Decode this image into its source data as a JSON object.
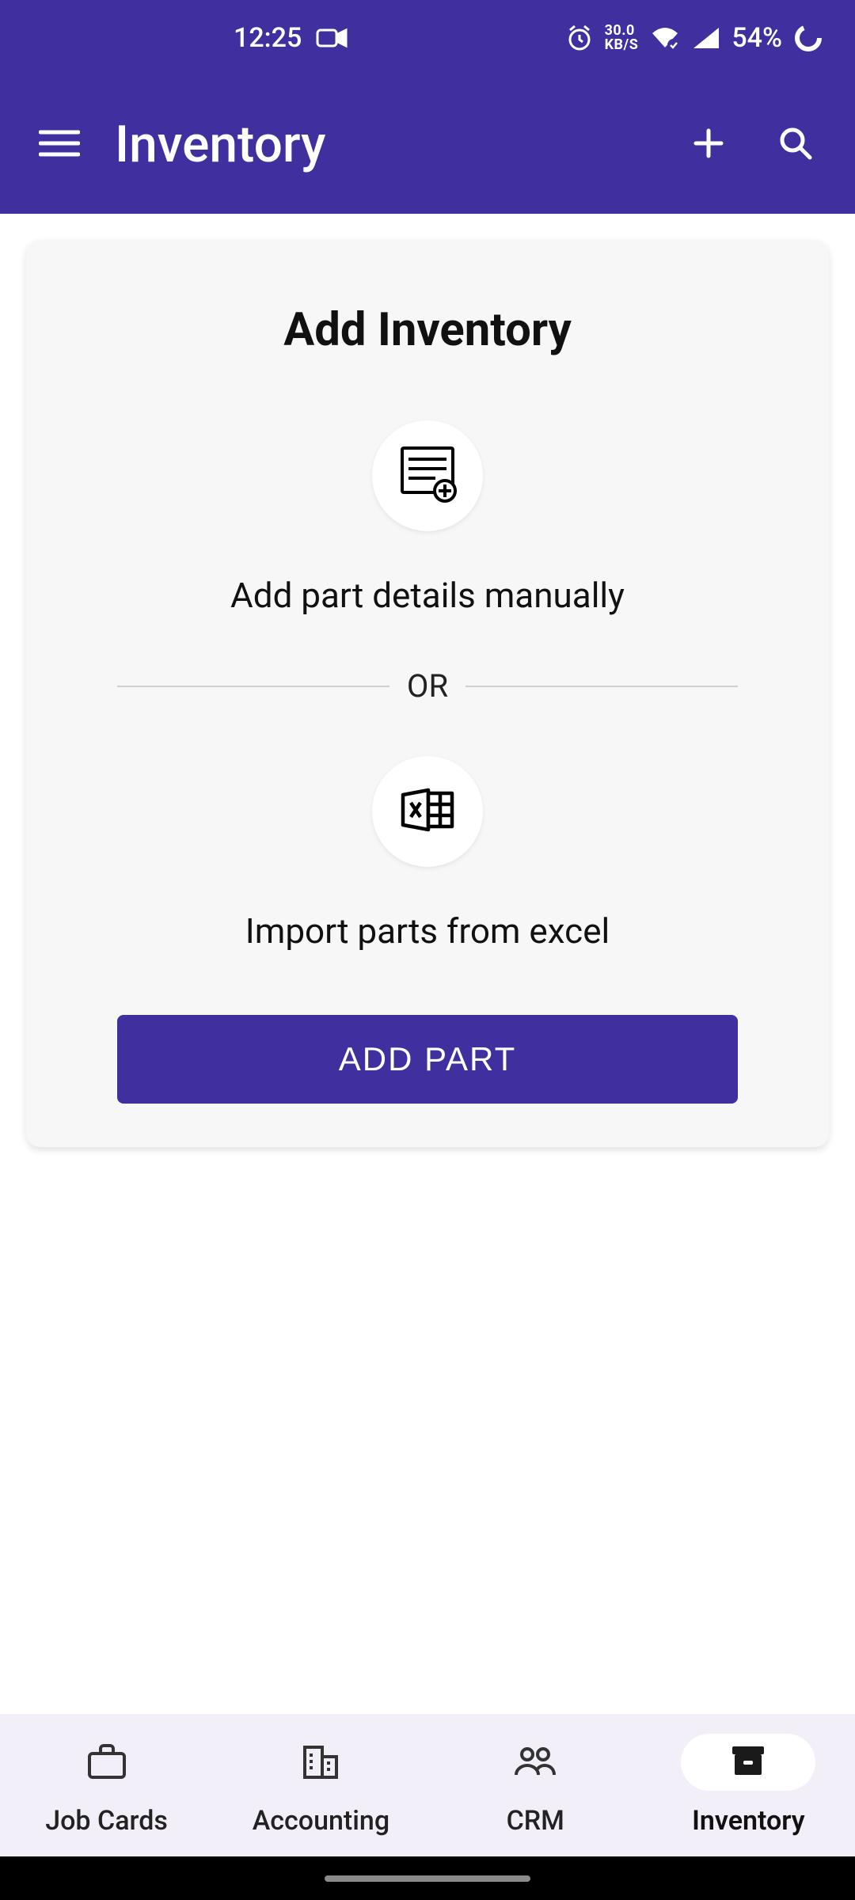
{
  "status": {
    "time": "12:25",
    "net_top": "30.0",
    "net_bottom": "KB/S",
    "battery": "54%"
  },
  "appbar": {
    "title": "Inventory"
  },
  "card": {
    "title": "Add Inventory",
    "manual_label": "Add part details manually",
    "divider": "OR",
    "import_label": "Import parts from excel",
    "button_label": "ADD PART"
  },
  "nav": {
    "items": [
      {
        "label": "Job Cards"
      },
      {
        "label": "Accounting"
      },
      {
        "label": "CRM"
      },
      {
        "label": "Inventory"
      }
    ]
  }
}
